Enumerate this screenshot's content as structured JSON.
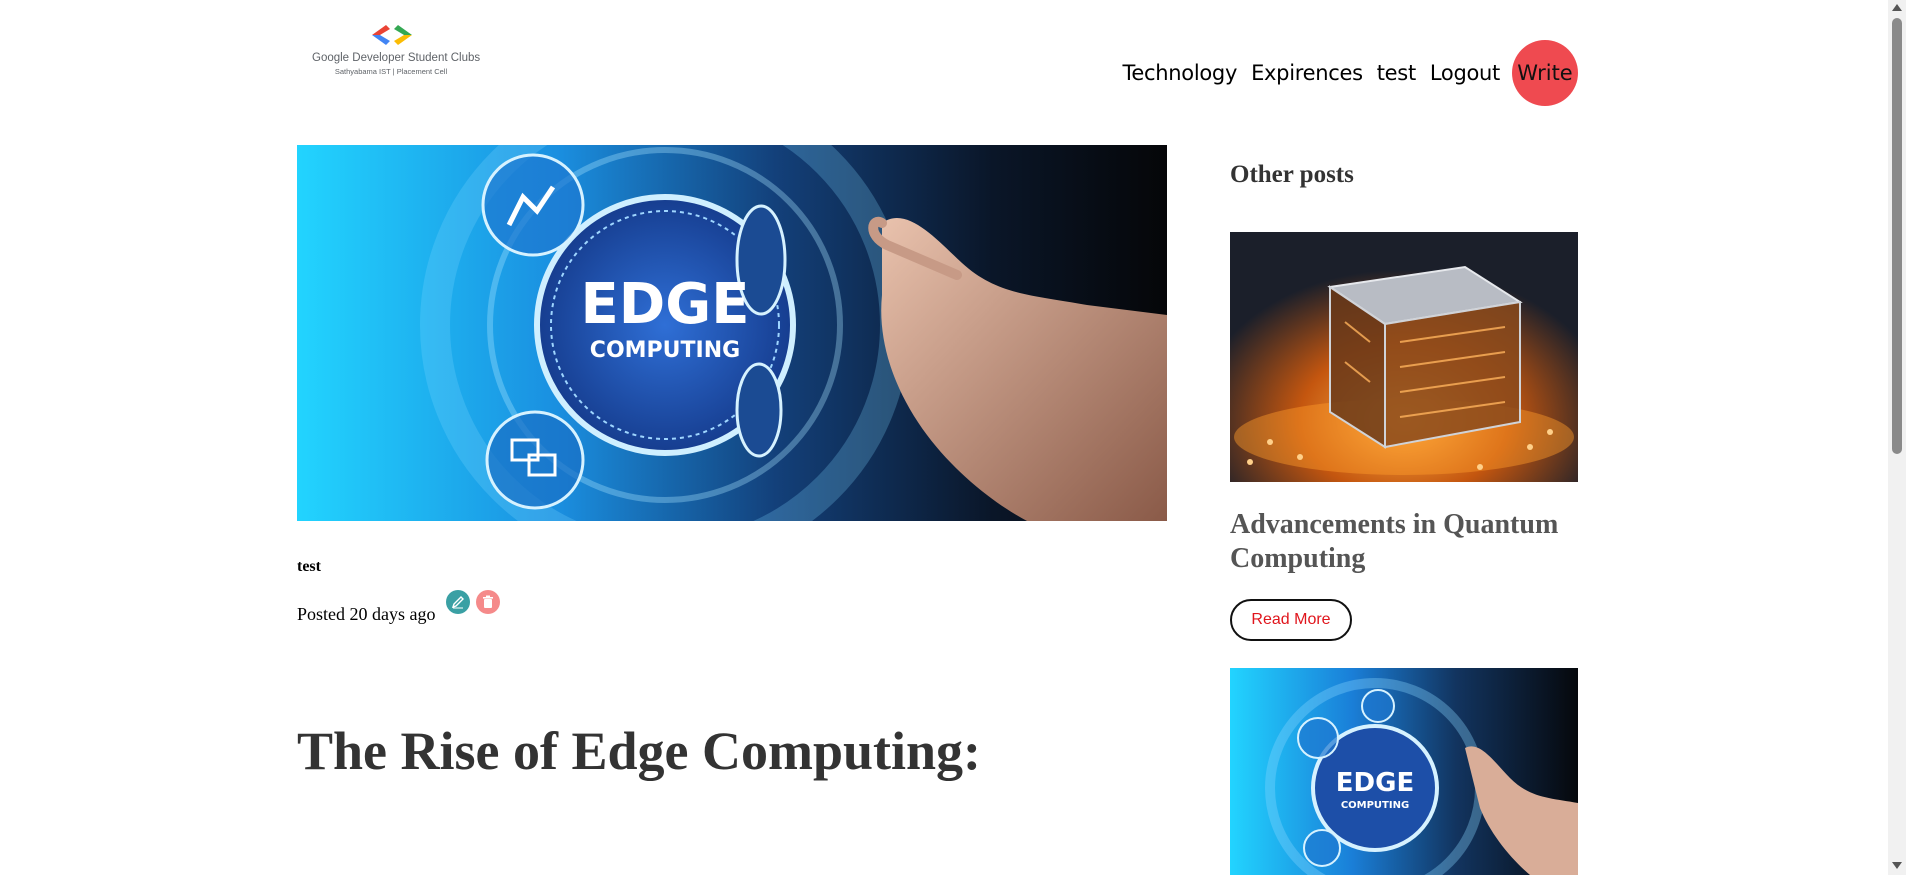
{
  "header": {
    "logo": {
      "brand": "Google Developer Student Clubs",
      "subtitle": "Sathyabama IST | Placement Cell"
    },
    "nav": [
      {
        "label": "Technology"
      },
      {
        "label": "Expirences"
      },
      {
        "label": "test"
      },
      {
        "label": "Logout"
      }
    ],
    "write_label": "Write",
    "write_color": "#ef4a50"
  },
  "post": {
    "hero_image": {
      "text_line1": "EDGE",
      "text_line2": "COMPUTING"
    },
    "author": "test",
    "posted": "Posted 20 days ago",
    "edit_icon": "pencil-icon",
    "delete_icon": "trash-icon",
    "title": "The Rise of Edge Computing:"
  },
  "sidebar": {
    "heading": "Other posts",
    "posts": [
      {
        "title": "Advancements in Quantum Computing",
        "read_more": "Read More"
      },
      {
        "image_text_line1": "EDGE",
        "image_text_line2": "COMPUTING"
      }
    ]
  }
}
